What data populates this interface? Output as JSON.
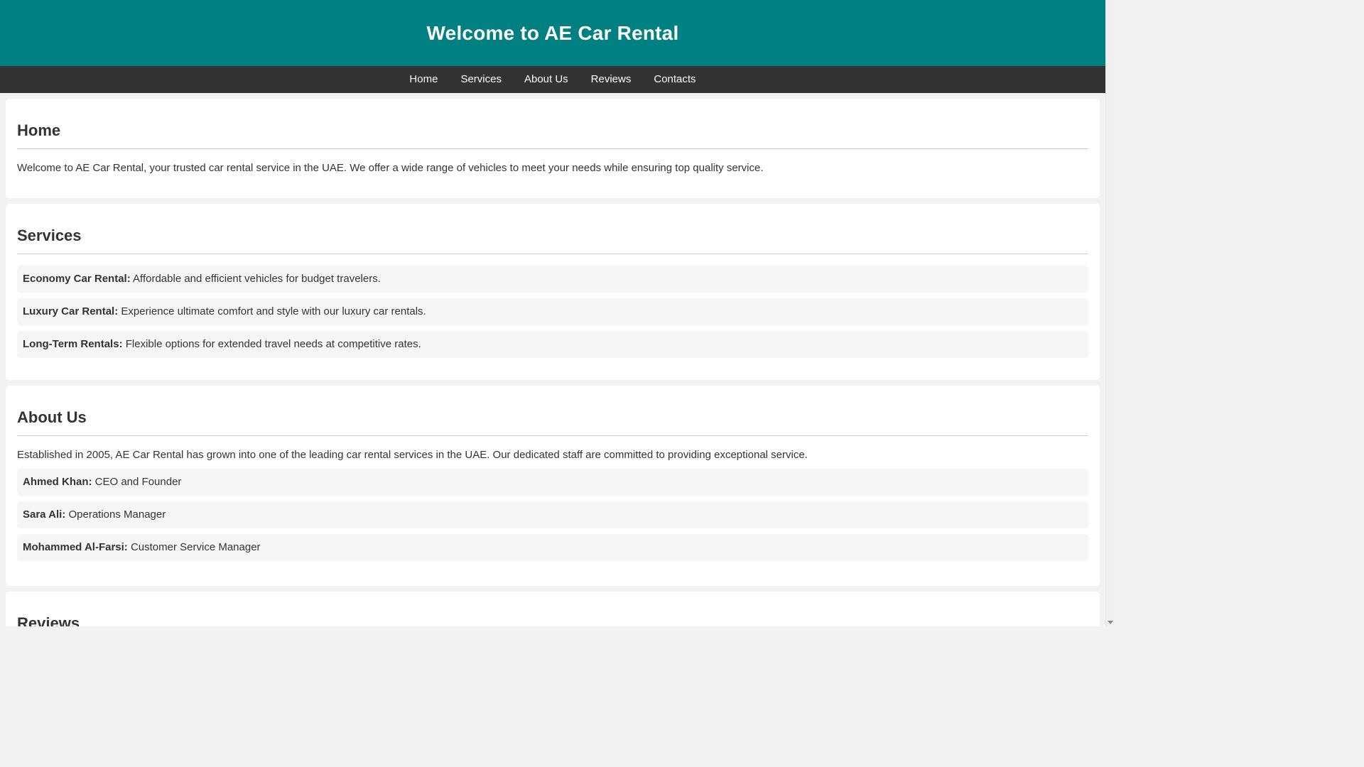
{
  "header": {
    "title": "Welcome to AE Car Rental"
  },
  "nav": {
    "items": [
      "Home",
      "Services",
      "About Us",
      "Reviews",
      "Contacts"
    ]
  },
  "home": {
    "heading": "Home",
    "text": "Welcome to AE Car Rental, your trusted car rental service in the UAE. We offer a wide range of vehicles to meet your needs while ensuring top quality service."
  },
  "services": {
    "heading": "Services",
    "items": [
      {
        "name": "Economy Car Rental:",
        "desc": "Affordable and efficient vehicles for budget travelers."
      },
      {
        "name": "Luxury Car Rental:",
        "desc": "Experience ultimate comfort and style with our luxury car rentals."
      },
      {
        "name": "Long-Term Rentals:",
        "desc": "Flexible options for extended travel needs at competitive rates."
      }
    ]
  },
  "about": {
    "heading": "About Us",
    "text": "Established in 2005, AE Car Rental has grown into one of the leading car rental services in the UAE. Our dedicated staff are committed to providing exceptional service.",
    "staff": [
      {
        "name": "Ahmed Khan:",
        "role": "CEO and Founder"
      },
      {
        "name": "Sara Ali:",
        "role": "Operations Manager"
      },
      {
        "name": "Mohammed Al-Farsi:",
        "role": "Customer Service Manager"
      }
    ]
  },
  "reviews": {
    "heading": "Reviews"
  },
  "colors": {
    "header_bg": "#008080",
    "nav_bg": "#333333",
    "page_bg": "#f2f2f2",
    "card_bg": "#ffffff"
  }
}
